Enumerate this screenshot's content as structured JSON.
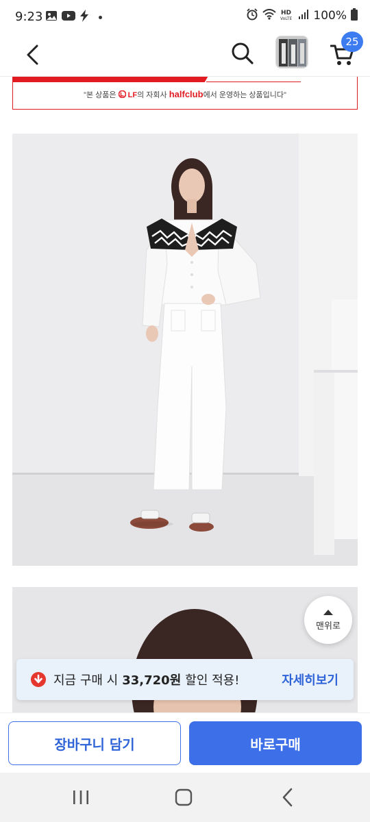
{
  "status_bar": {
    "time": "9:23",
    "battery": "100%",
    "icons_left": [
      "gallery-icon",
      "youtube-icon",
      "bolt-icon",
      "dot-icon"
    ],
    "icons_right": [
      "alarm-icon",
      "wifi-icon",
      "hd-voice-icon",
      "signal-icon",
      "battery-icon"
    ]
  },
  "app_bar": {
    "back_icon": "chevron-left-icon",
    "search_icon": "search-icon",
    "cart_icon": "cart-icon",
    "cart_count": "25"
  },
  "notice": {
    "prefix": "\"본 상품은",
    "brand_lf": "LF",
    "middle": "의 자회사",
    "brand_halfclub": "halfclub",
    "suffix": "에서 운영하는 상품입니다\""
  },
  "top_button": {
    "label": "맨위로"
  },
  "discount_toast": {
    "prefix": "지금 구매 시",
    "amount": "33,720원",
    "suffix": "할인 적용!",
    "link": "자세히보기",
    "icon": "arrow-down-circle-icon"
  },
  "actions": {
    "add_to_cart": "장바구니 담기",
    "buy_now": "바로구매"
  },
  "nav_bar": {
    "recent": "recents-icon",
    "home": "home-icon",
    "back": "back-icon"
  },
  "colors": {
    "accent_blue": "#3d6fe8",
    "brand_red": "#e21b23",
    "toast_bg": "#e9f1fb"
  }
}
